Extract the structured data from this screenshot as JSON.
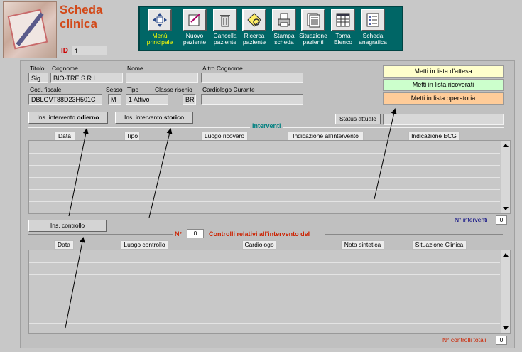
{
  "header": {
    "title_line1": "Scheda",
    "title_line2": "clinica",
    "id_label": "ID",
    "id_value": "1"
  },
  "toolbar": {
    "buttons": [
      {
        "label1": "Menù",
        "label2": "principale",
        "icon": "move-arrows-icon"
      },
      {
        "label1": "Nuovo",
        "label2": "paziente",
        "icon": "new-document-icon"
      },
      {
        "label1": "Cancella",
        "label2": "paziente",
        "icon": "trash-icon"
      },
      {
        "label1": "Ricerca",
        "label2": "paziente",
        "icon": "search-icon"
      },
      {
        "label1": "Stampa",
        "label2": "scheda",
        "icon": "printer-icon"
      },
      {
        "label1": "Situazione",
        "label2": "pazienti",
        "icon": "document-list-icon"
      },
      {
        "label1": "Torna",
        "label2": "Elenco",
        "icon": "table-icon"
      },
      {
        "label1": "Scheda",
        "label2": "anagrafica",
        "icon": "form-icon"
      }
    ]
  },
  "patient": {
    "titolo_label": "Titolo",
    "titolo_value": "Sig.",
    "cognome_label": "Cognome",
    "cognome_value": "BIO-TRE S.R.L.",
    "nome_label": "Nome",
    "nome_value": "",
    "altro_cognome_label": "Altro Cognome",
    "altro_cognome_value": "",
    "cod_fiscale_label": "Cod. fiscale",
    "cod_fiscale_value": "DBLGVT88D23H501C",
    "sesso_label": "Sesso",
    "sesso_value": "M",
    "tipo_label": "Tipo",
    "tipo_value": "1 Attivo",
    "classe_rischio_label": "Classe rischio",
    "classe_rischio_value": "BR",
    "cardiologo_label": "Cardiologo Curante",
    "cardiologo_value": ""
  },
  "liste": {
    "attesa": "Metti in lista d'attesa",
    "ricoverati": "Metti in lista ricoverati",
    "operatoria": "Metti in lista operatoria"
  },
  "interventi": {
    "btn_odierno_prefix": "Ins. intervento ",
    "btn_odierno_bold": "odierno",
    "btn_storico_prefix": "Ins. intervento ",
    "btn_storico_bold": "storico",
    "status_label": "Status attuale",
    "status_value": "",
    "section_title": "Interventi",
    "columns": [
      "Data",
      "Tipo",
      "Luogo ricovero",
      "Indicazione all'intervento",
      "Indicazione ECG"
    ],
    "count_label": "N° interventi",
    "count_value": "0"
  },
  "controlli": {
    "btn_label": "Ins. controllo",
    "n_label": "N°",
    "n_value": "0",
    "section_title": "Controlli relativi all'intervento del",
    "columns": [
      "Data",
      "Luogo controllo",
      "Cardiologo",
      "Nota sintetica",
      "Situazione Clinica"
    ],
    "count_label": "N° controlli totali",
    "count_value": "0"
  },
  "colors": {
    "toolbar_bg": "#006666",
    "title_red": "#d24a1a",
    "teal_text": "#008080",
    "lista_attesa": "#ffffcc",
    "lista_ricoverati": "#ccffcc",
    "lista_operatoria": "#ffcc99",
    "count_interventi_color": "#000080",
    "count_controlli_color": "#cc2200"
  }
}
